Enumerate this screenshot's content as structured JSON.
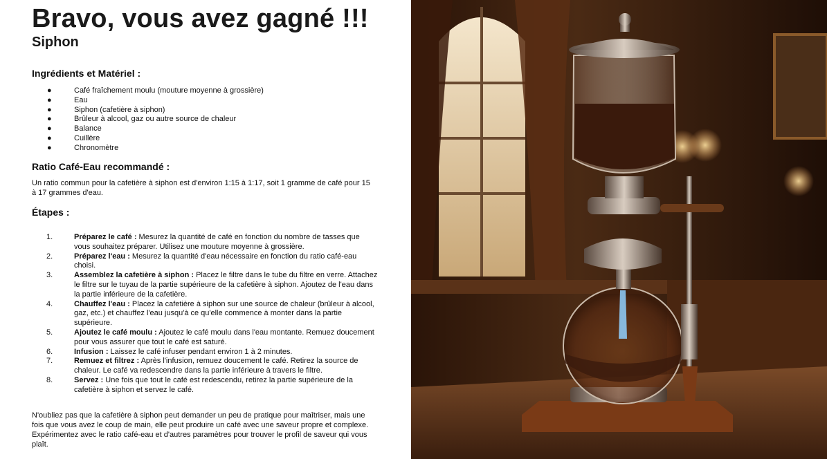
{
  "title": "Bravo, vous avez gagné !!!",
  "subtitle": "Siphon",
  "ingredients": {
    "heading": "Ingrédients et Matériel :",
    "bullet": "●",
    "items": [
      "Café fraîchement moulu (mouture moyenne à grossière)",
      "Eau",
      "Siphon (cafetière à siphon)",
      "Brûleur à alcool, gaz ou autre source de chaleur",
      "Balance",
      "Cuillère",
      "Chronomètre"
    ]
  },
  "ratio": {
    "heading": "Ratio Café-Eau recommandé :",
    "text": "Un ratio commun pour la cafetière à siphon est d'environ 1:15 à 1:17, soit 1 gramme de café pour 15 à 17 grammes d'eau."
  },
  "steps": {
    "heading": "Étapes :",
    "items": [
      {
        "num": "1.",
        "title": "Préparez le café :",
        "text": " Mesurez la quantité de café en fonction du nombre de tasses que vous souhaitez préparer. Utilisez une mouture moyenne à grossière."
      },
      {
        "num": "2.",
        "title": "Préparez l'eau :",
        "text": " Mesurez la quantité d'eau nécessaire en fonction du ratio café-eau choisi."
      },
      {
        "num": "3.",
        "title": "Assemblez la cafetière à siphon :",
        "text": " Placez le filtre dans le tube du filtre en verre. Attachez le filtre sur le tuyau de la partie supérieure de la cafetière à siphon. Ajoutez de l'eau dans la partie inférieure de la cafetière."
      },
      {
        "num": "4.",
        "title": "Chauffez l'eau :",
        "text": " Placez la cafetière à siphon sur une source de chaleur (brûleur à alcool, gaz, etc.) et chauffez l'eau jusqu'à ce qu'elle commence à monter dans la partie supérieure."
      },
      {
        "num": "5.",
        "title": "Ajoutez le café moulu :",
        "text": " Ajoutez le café moulu dans l'eau montante. Remuez doucement pour vous assurer que tout le café est saturé."
      },
      {
        "num": "6.",
        "title": "Infusion :",
        "text": " Laissez le café infuser pendant environ 1 à 2 minutes."
      },
      {
        "num": "7.",
        "title": "Remuez et filtrez :",
        "text": " Après l'infusion, remuez doucement le café. Retirez la source de chaleur. Le café va redescendre dans la partie inférieure à travers le filtre."
      },
      {
        "num": "8.",
        "title": "Servez :",
        "text": " Une fois que tout le café est redescendu, retirez la partie supérieure de la cafetière à siphon et servez le café."
      }
    ]
  },
  "note": "N'oubliez pas que la cafetière à siphon peut demander un peu de pratique pour maîtriser, mais une fois que vous avez le coup de main, elle peut produire un café avec une saveur propre et complexe. Expérimentez avec le ratio café-eau et d'autres paramètres pour trouver le profil de saveur qui vous plaît.",
  "colors": {
    "coffee": "#3a1a0c",
    "wood": "#6b3a1c",
    "brass": "#b0a090",
    "flame": "#8fd0ff"
  }
}
